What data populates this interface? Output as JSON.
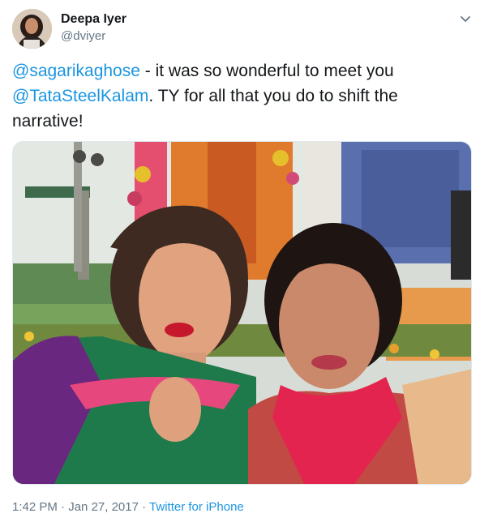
{
  "author": {
    "name": "Deepa Iyer",
    "handle": "@dviyer"
  },
  "tweet": {
    "line1_mention": "@sagarikaghose",
    "line1_text": " - it was so wonderful to meet you",
    "line2_mention": "@TataSteelKalam",
    "line2_text": ". TY for all that you do to shift the",
    "line3_text": "narrative!"
  },
  "footer": {
    "time": "1:42 PM",
    "separator1": " · ",
    "date": "Jan 27, 2017",
    "separator2": " · ",
    "source": "Twitter for iPhone"
  },
  "icons": {
    "menu": "chevron-down-icon",
    "avatar": "user-photo"
  },
  "colors": {
    "link": "#1b95e0",
    "text": "#14171a",
    "secondary": "#657786"
  }
}
